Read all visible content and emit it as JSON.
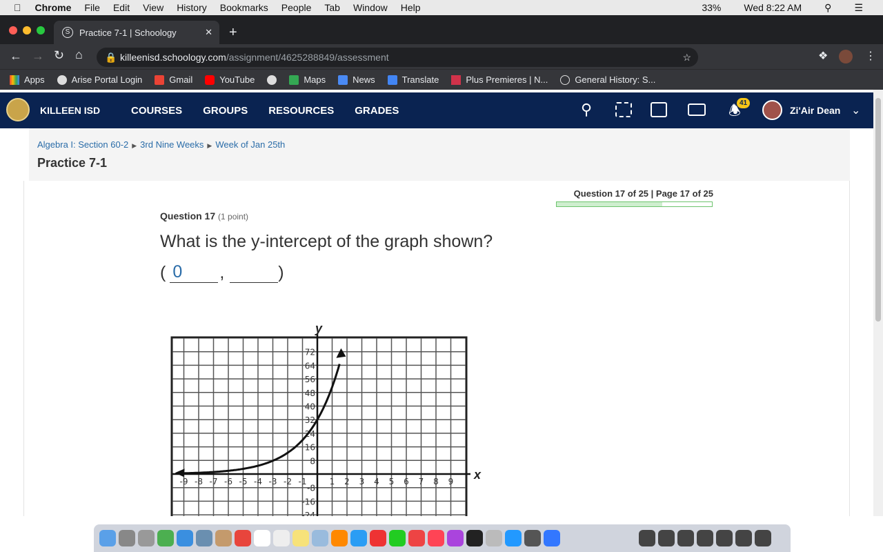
{
  "menubar": {
    "app": "Chrome",
    "items": [
      "File",
      "Edit",
      "View",
      "History",
      "Bookmarks",
      "People",
      "Tab",
      "Window",
      "Help"
    ],
    "battery": "33%",
    "clock": "Wed 8:22 AM"
  },
  "browser": {
    "tab_title": "Practice 7-1 | Schoology",
    "url_host": "killeenisd.schoology.com",
    "url_path": "/assignment/4625288849/assessment"
  },
  "bookmarks": [
    "Apps",
    "Arise Portal Login",
    "Gmail",
    "YouTube",
    "",
    "Maps",
    "News",
    "Translate",
    "Plus Premieres | N...",
    "General History: S..."
  ],
  "nav": {
    "org": "KILLEEN ISD",
    "links": [
      "COURSES",
      "GROUPS",
      "RESOURCES",
      "GRADES"
    ],
    "notifications": "41",
    "user": "Zi'Air Dean"
  },
  "breadcrumb": [
    "Algebra I: Section 60-2",
    "3rd Nine Weeks",
    "Week of Jan 25th"
  ],
  "page_title": "Practice 7-1",
  "progress": {
    "label": "Question 17 of 25 | Page 17 of 25",
    "fraction": 0.68
  },
  "question": {
    "number": "Question 17",
    "points": "(1 point)",
    "text": "What is the y-intercept of the graph shown?",
    "open": "(",
    "comma": ",",
    "close": ")",
    "answer_x": "0",
    "answer_y": ""
  },
  "graph": {
    "x_label": "x",
    "y_label": "y",
    "y_ticks": [
      72,
      64,
      56,
      48,
      40,
      32,
      24,
      16,
      8,
      -8,
      -16,
      -24
    ],
    "x_ticks": [
      -9,
      -8,
      -7,
      -6,
      -5,
      -4,
      -3,
      -2,
      -1,
      1,
      2,
      3,
      4,
      5,
      6,
      7,
      8,
      9
    ]
  },
  "colors": {
    "nav": "#0a2351",
    "link": "#2a6ca8",
    "progress": "#6cc36c"
  }
}
